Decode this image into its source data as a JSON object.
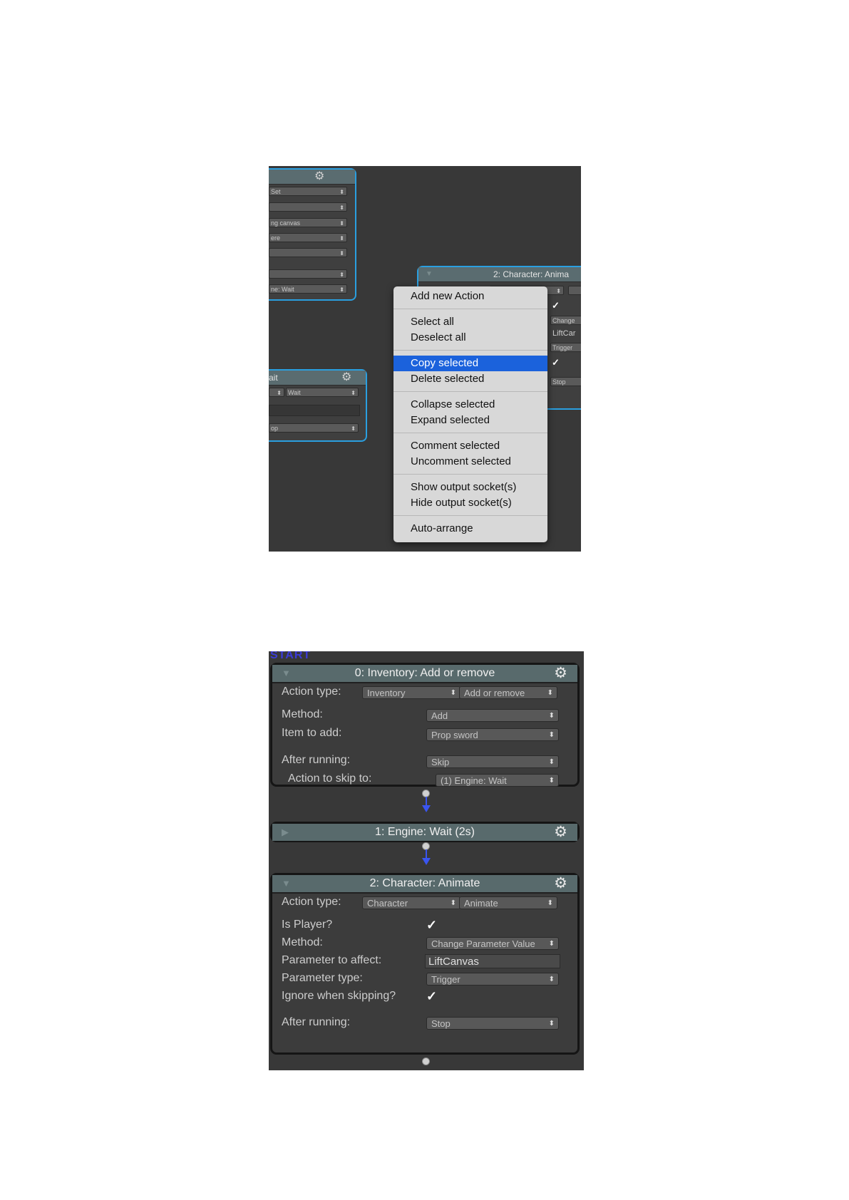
{
  "top": {
    "node_a": {
      "fields": [
        "Set",
        "",
        "ng canvas",
        "ere",
        "",
        "",
        "ne: Wait"
      ]
    },
    "node_b": {
      "title": "ait",
      "dd_left": "",
      "dd_right": "Wait",
      "dd_bottom": "op"
    },
    "node_c": {
      "title": "2: Character: Anima",
      "fields": [
        "Change",
        "LiftCar",
        "Trigger",
        "Stop"
      ]
    },
    "menu": {
      "items": [
        "Add new Action",
        "Select all",
        "Deselect all",
        "Copy selected",
        "Delete selected",
        "Collapse selected",
        "Expand selected",
        "Comment selected",
        "Uncomment selected",
        "Show output socket(s)",
        "Hide output socket(s)",
        "Auto-arrange"
      ],
      "highlighted": "Copy selected"
    }
  },
  "bottom": {
    "start_label": "START",
    "node0": {
      "title": "0: Inventory: Add or remove",
      "action_type_label": "Action type:",
      "action_type_a": "Inventory",
      "action_type_b": "Add or remove",
      "method_label": "Method:",
      "method_value": "Add",
      "item_label": "Item to add:",
      "item_value": "Prop sword",
      "after_label": "After running:",
      "after_value": "Skip",
      "skip_label": "Action to skip to:",
      "skip_value": "(1) Engine: Wait"
    },
    "node1": {
      "title": "1: Engine: Wait (2s)"
    },
    "node2": {
      "title": "2: Character: Animate",
      "action_type_label": "Action type:",
      "action_type_a": "Character",
      "action_type_b": "Animate",
      "is_player_label": "Is Player?",
      "method_label": "Method:",
      "method_value": "Change Parameter Value",
      "param_label": "Parameter to affect:",
      "param_value": "LiftCanvas",
      "param_type_label": "Parameter type:",
      "param_type_value": "Trigger",
      "ignore_label": "Ignore when skipping?",
      "after_label": "After running:",
      "after_value": "Stop"
    }
  }
}
